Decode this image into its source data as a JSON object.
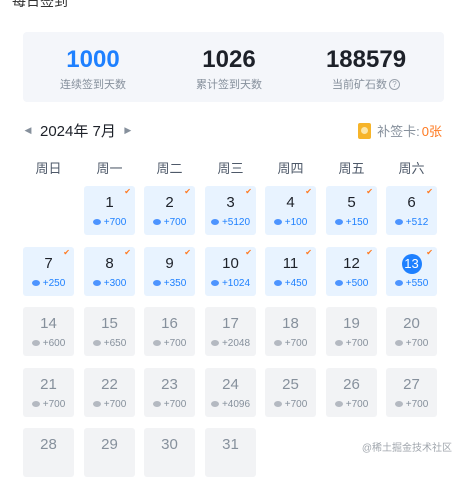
{
  "page_title": "每日签到",
  "stats": [
    {
      "value": "1000",
      "label": "连续签到天数",
      "color": "#1e80ff",
      "help": false
    },
    {
      "value": "1026",
      "label": "累计签到天数",
      "color": "#1d2129",
      "help": false
    },
    {
      "value": "188579",
      "label": "当前矿石数",
      "color": "#1d2129",
      "help": true
    }
  ],
  "nav": {
    "prev_icon": "◀",
    "next_icon": "▶",
    "month": "2024年 7月"
  },
  "card": {
    "icon": "ticket-icon",
    "label": "补签卡:",
    "count": "0张"
  },
  "weekdays": [
    "周日",
    "周一",
    "周二",
    "周三",
    "周四",
    "周五",
    "周六"
  ],
  "days": [
    {
      "day": "1",
      "points": "+700",
      "state": "signed"
    },
    {
      "day": "2",
      "points": "+700",
      "state": "signed"
    },
    {
      "day": "3",
      "points": "+5120",
      "state": "signed"
    },
    {
      "day": "4",
      "points": "+100",
      "state": "signed"
    },
    {
      "day": "5",
      "points": "+150",
      "state": "signed"
    },
    {
      "day": "6",
      "points": "+512",
      "state": "signed"
    },
    {
      "day": "7",
      "points": "+250",
      "state": "signed"
    },
    {
      "day": "8",
      "points": "+300",
      "state": "signed"
    },
    {
      "day": "9",
      "points": "+350",
      "state": "signed"
    },
    {
      "day": "10",
      "points": "+1024",
      "state": "signed"
    },
    {
      "day": "11",
      "points": "+450",
      "state": "signed"
    },
    {
      "day": "12",
      "points": "+500",
      "state": "signed"
    },
    {
      "day": "13",
      "points": "+550",
      "state": "today"
    },
    {
      "day": "14",
      "points": "+600",
      "state": "future"
    },
    {
      "day": "15",
      "points": "+650",
      "state": "future"
    },
    {
      "day": "16",
      "points": "+700",
      "state": "future"
    },
    {
      "day": "17",
      "points": "+2048",
      "state": "future"
    },
    {
      "day": "18",
      "points": "+700",
      "state": "future"
    },
    {
      "day": "19",
      "points": "+700",
      "state": "future"
    },
    {
      "day": "20",
      "points": "+700",
      "state": "future"
    },
    {
      "day": "21",
      "points": "+700",
      "state": "future"
    },
    {
      "day": "22",
      "points": "+700",
      "state": "future"
    },
    {
      "day": "23",
      "points": "+700",
      "state": "future"
    },
    {
      "day": "24",
      "points": "+4096",
      "state": "future"
    },
    {
      "day": "25",
      "points": "+700",
      "state": "future"
    },
    {
      "day": "26",
      "points": "+700",
      "state": "future"
    },
    {
      "day": "27",
      "points": "+700",
      "state": "future"
    },
    {
      "day": "28",
      "points": "",
      "state": "future"
    },
    {
      "day": "29",
      "points": "",
      "state": "future"
    },
    {
      "day": "30",
      "points": "",
      "state": "future"
    },
    {
      "day": "31",
      "points": "",
      "state": "future"
    }
  ],
  "watermark": "@稀土掘金技术社区",
  "colors": {
    "accent": "#1e80ff",
    "check": "#ff7a21",
    "signed_bg": "#e8f3ff",
    "future_bg": "#f2f3f5"
  }
}
